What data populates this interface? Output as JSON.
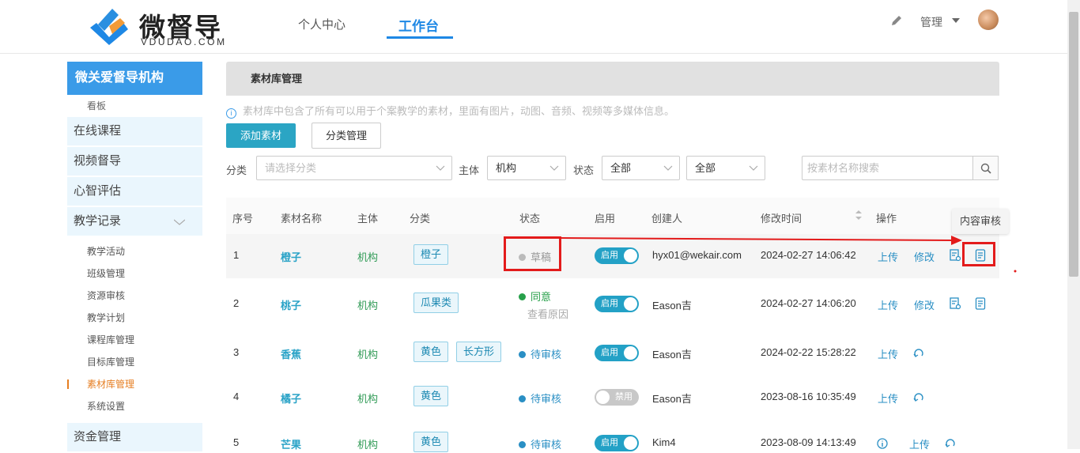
{
  "brand": {
    "name": "微督导",
    "sub": "VDUDAO.COM"
  },
  "nav": {
    "items": [
      "个人中心",
      "工作台"
    ],
    "active": "工作台"
  },
  "header_right": {
    "user_menu": "管理"
  },
  "sidebar": {
    "org": "微关爱督导机构",
    "sub_item": "看板",
    "main_items": [
      "在线课程",
      "视频督导",
      "心智评估",
      "教学记录"
    ],
    "leaves": [
      "教学活动",
      "班级管理",
      "资源审核",
      "教学计划",
      "课程库管理",
      "目标库管理",
      "素材库管理",
      "系统设置"
    ],
    "active_leaf": "素材库管理",
    "bottom_item": "资金管理"
  },
  "page": {
    "title": "素材库管理",
    "info": "素材库中包含了所有可以用于个案教学的素材，里面有图片，动图、音频、视频等多媒体信息。",
    "add_button": "添加素材",
    "category_button": "分类管理"
  },
  "filters": {
    "category_label": "分类",
    "category_placeholder": "请选择分类",
    "subject_label": "主体",
    "subject_value": "机构",
    "status_label": "状态",
    "status_value": "全部",
    "extra_value": "全部",
    "search_placeholder": "按素材名称搜索"
  },
  "table": {
    "headers": [
      "序号",
      "素材名称",
      "主体",
      "分类",
      "状态",
      "启用",
      "创建人",
      "修改时间",
      "操作"
    ],
    "rows": [
      {
        "no": "1",
        "name": "橙子",
        "subject": "机构",
        "tags": [
          "橙子"
        ],
        "status": "草稿",
        "status_color": "#bbbbbb",
        "enabled": "启用",
        "on": true,
        "creator": "hyx01@wekair.com",
        "time": "2024-02-27 14:06:42",
        "ops": [
          "上传",
          "修改"
        ]
      },
      {
        "no": "2",
        "name": "桃子",
        "subject": "机构",
        "tags": [
          "瓜果类"
        ],
        "status": "同意",
        "status_color": "#27a04a",
        "status_sub": "查看原因",
        "enabled": "启用",
        "on": true,
        "creator": "Eason吉",
        "time": "2024-02-27 14:06:20",
        "ops": [
          "上传",
          "修改"
        ]
      },
      {
        "no": "3",
        "name": "香蕉",
        "subject": "机构",
        "tags": [
          "黄色",
          "长方形"
        ],
        "status": "待审核",
        "status_color": "#2a8fc4",
        "enabled": "启用",
        "on": true,
        "creator": "Eason吉",
        "time": "2024-02-22 15:28:22",
        "ops": [
          "上传"
        ]
      },
      {
        "no": "4",
        "name": "橘子",
        "subject": "机构",
        "tags": [
          "黄色"
        ],
        "status": "待审核",
        "status_color": "#2a8fc4",
        "enabled": "禁用",
        "on": false,
        "creator": "Eason吉",
        "time": "2023-08-16 10:35:49",
        "ops": [
          "上传"
        ]
      },
      {
        "no": "5",
        "name": "芒果",
        "subject": "机构",
        "tags": [
          "黄色"
        ],
        "status": "待审核",
        "status_color": "#2a8fc4",
        "enabled": "启用",
        "on": true,
        "creator": "Kim4",
        "time": "2023-08-09 14:13:49",
        "ops": [
          "上传"
        ]
      }
    ]
  },
  "tooltip": "内容审核",
  "colors": {
    "accent": "#1e88e5",
    "primary_button": "#2ba5c4",
    "annotation": "#e31b1b"
  }
}
